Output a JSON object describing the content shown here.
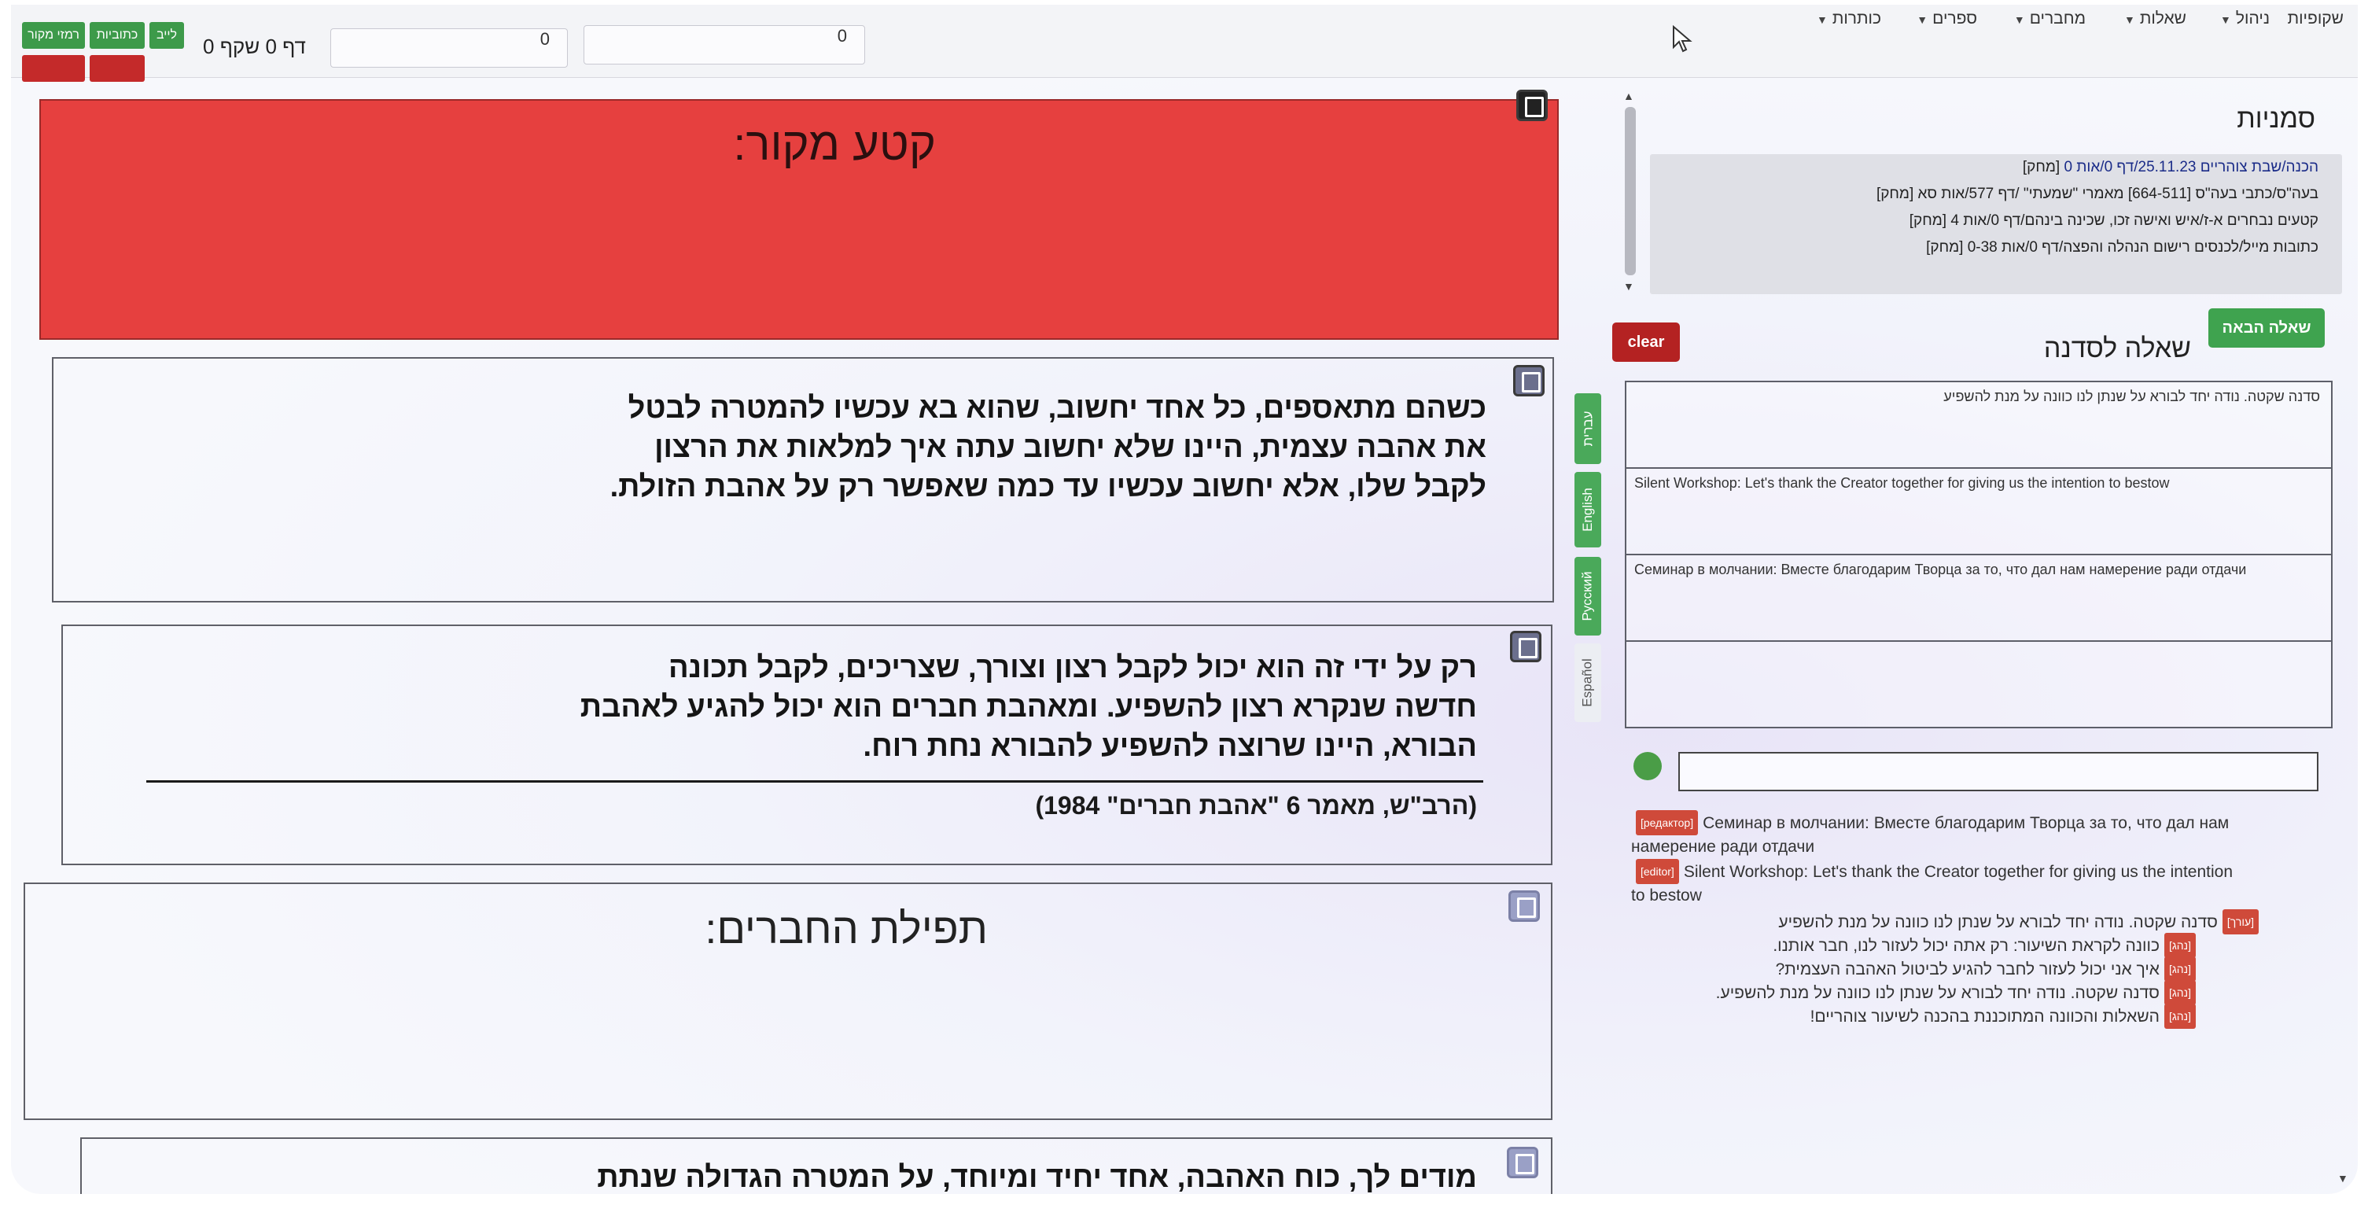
{
  "navbar": {
    "items": [
      {
        "label": "שקופיות",
        "caret": false
      },
      {
        "label": "ניהול",
        "caret": true
      },
      {
        "label": "שאלות",
        "caret": true
      },
      {
        "label": "מחברים",
        "caret": true
      },
      {
        "label": "ספרים",
        "caret": true
      },
      {
        "label": "כותרות",
        "caret": true
      }
    ],
    "pills_row1": [
      "לייב",
      "כתוביות",
      "רמזי מקור"
    ],
    "pills_row2": [
      "",
      ""
    ],
    "input_a_value": "0",
    "input_b_value": "0",
    "page_info": "דף 0 שקף 0"
  },
  "source_banner": {
    "title": "קטע מקור:"
  },
  "text_blocks": [
    {
      "lines": [
        "כשהם מתאספים, כל אחד יחשוב, שהוא בא עכשיו להמטרה לבטל",
        "את אהבה עצמית, היינו שלא יחשוב עתה איך למלאות את הרצון",
        "לקבל שלו, אלא יחשוב עכשיו עד כמה שאפשר רק על אהבת הזולת."
      ]
    },
    {
      "lines": [
        "רק על ידי זה הוא יכול לקבל רצון וצורך, שצריכים, לקבל תכונה",
        "חדשה שנקרא רצון להשפיע. ומאהבת חברים הוא יכול להגיע לאהבת",
        "הבורא, היינו שרוצה להשפיע להבורא נחת רוח."
      ],
      "citation": "(הרב\"ש, מאמר 6 \"אהבת חברים\" 1984)"
    },
    {
      "title": "תפילת החברים:"
    },
    {
      "lines": [
        "מודים לך, כוח האהבה, אחד יחיד ומיוחד, על המטרה הגדולה שנתת"
      ]
    }
  ],
  "language_tabs": [
    {
      "label": "עברית",
      "active": true
    },
    {
      "label": "English",
      "active": true
    },
    {
      "label": "Русский",
      "active": true
    },
    {
      "label": "Español",
      "active": false
    }
  ],
  "bookmarks": {
    "title": "סמניות",
    "delete_label": "[מחק]",
    "items": [
      "הכנה/שבת צוהריים 25.11.23/דף 0/אות 0",
      "בעה\"ס/כתבי בעה\"ס [664-511] מאמרי \"שמעתי\" /דף 577/אות סא",
      "קטעים נבחרים א-ז/איש ואישה זכו, שכינה בינהם/דף 0/אות 4",
      "כתובות מייל/לכנסים רישום הנהלה והפצה/דף 0/אות 0-38"
    ]
  },
  "question_panel": {
    "title": "שאלה לסדנה",
    "clear_label": "clear",
    "next_label": "שאלה הבאה",
    "fields": [
      "סדנה שקטה. נודה יחד לבורא על שנתן לנו כוונה על מנת להשפיע",
      "Silent Workshop: Let's thank the Creator together for giving us the intention to bestow",
      "Семинар в молчании: Вместе благодарим Творца за то, что дал нам намерение ради отдачи",
      ""
    ]
  },
  "history": {
    "items": [
      {
        "tag": "[редактор]",
        "text": "Семинар в молчании: Вместе благодарим Творца за то, что дал нам",
        "text2": "намерение ради отдачи",
        "dir": "ltr"
      },
      {
        "tag": "[editor]",
        "text": "Silent Workshop: Let's thank the Creator together for giving us the intention",
        "text2": "to bestow",
        "dir": "ltr"
      },
      {
        "tag": "[עורך]",
        "text": "סדנה שקטה. נודה יחד לבורא על שנתן לנו כוונה על מנת להשפיע",
        "dir": "rtl"
      },
      {
        "tag": "[נהג]",
        "text": "כוונה לקראת השיעור: רק אתה יכול לעזור לנו, חבר אותנו.",
        "dir": "rtl"
      },
      {
        "tag": "[נהג]",
        "text": "איך אני יכול לעזור לחבר להגיע לביטול האהבה העצמית?",
        "dir": "rtl"
      },
      {
        "tag": "[נהג]",
        "text": "סדנה שקטה. נודה יחד לבורא על שנתן לנו כוונה על מנת להשפיע.",
        "dir": "rtl"
      },
      {
        "tag": "[נהג]",
        "text": "השאלות והכוונה המתוכננת בהכנה לשיעור צוהריים!",
        "dir": "rtl"
      }
    ]
  }
}
